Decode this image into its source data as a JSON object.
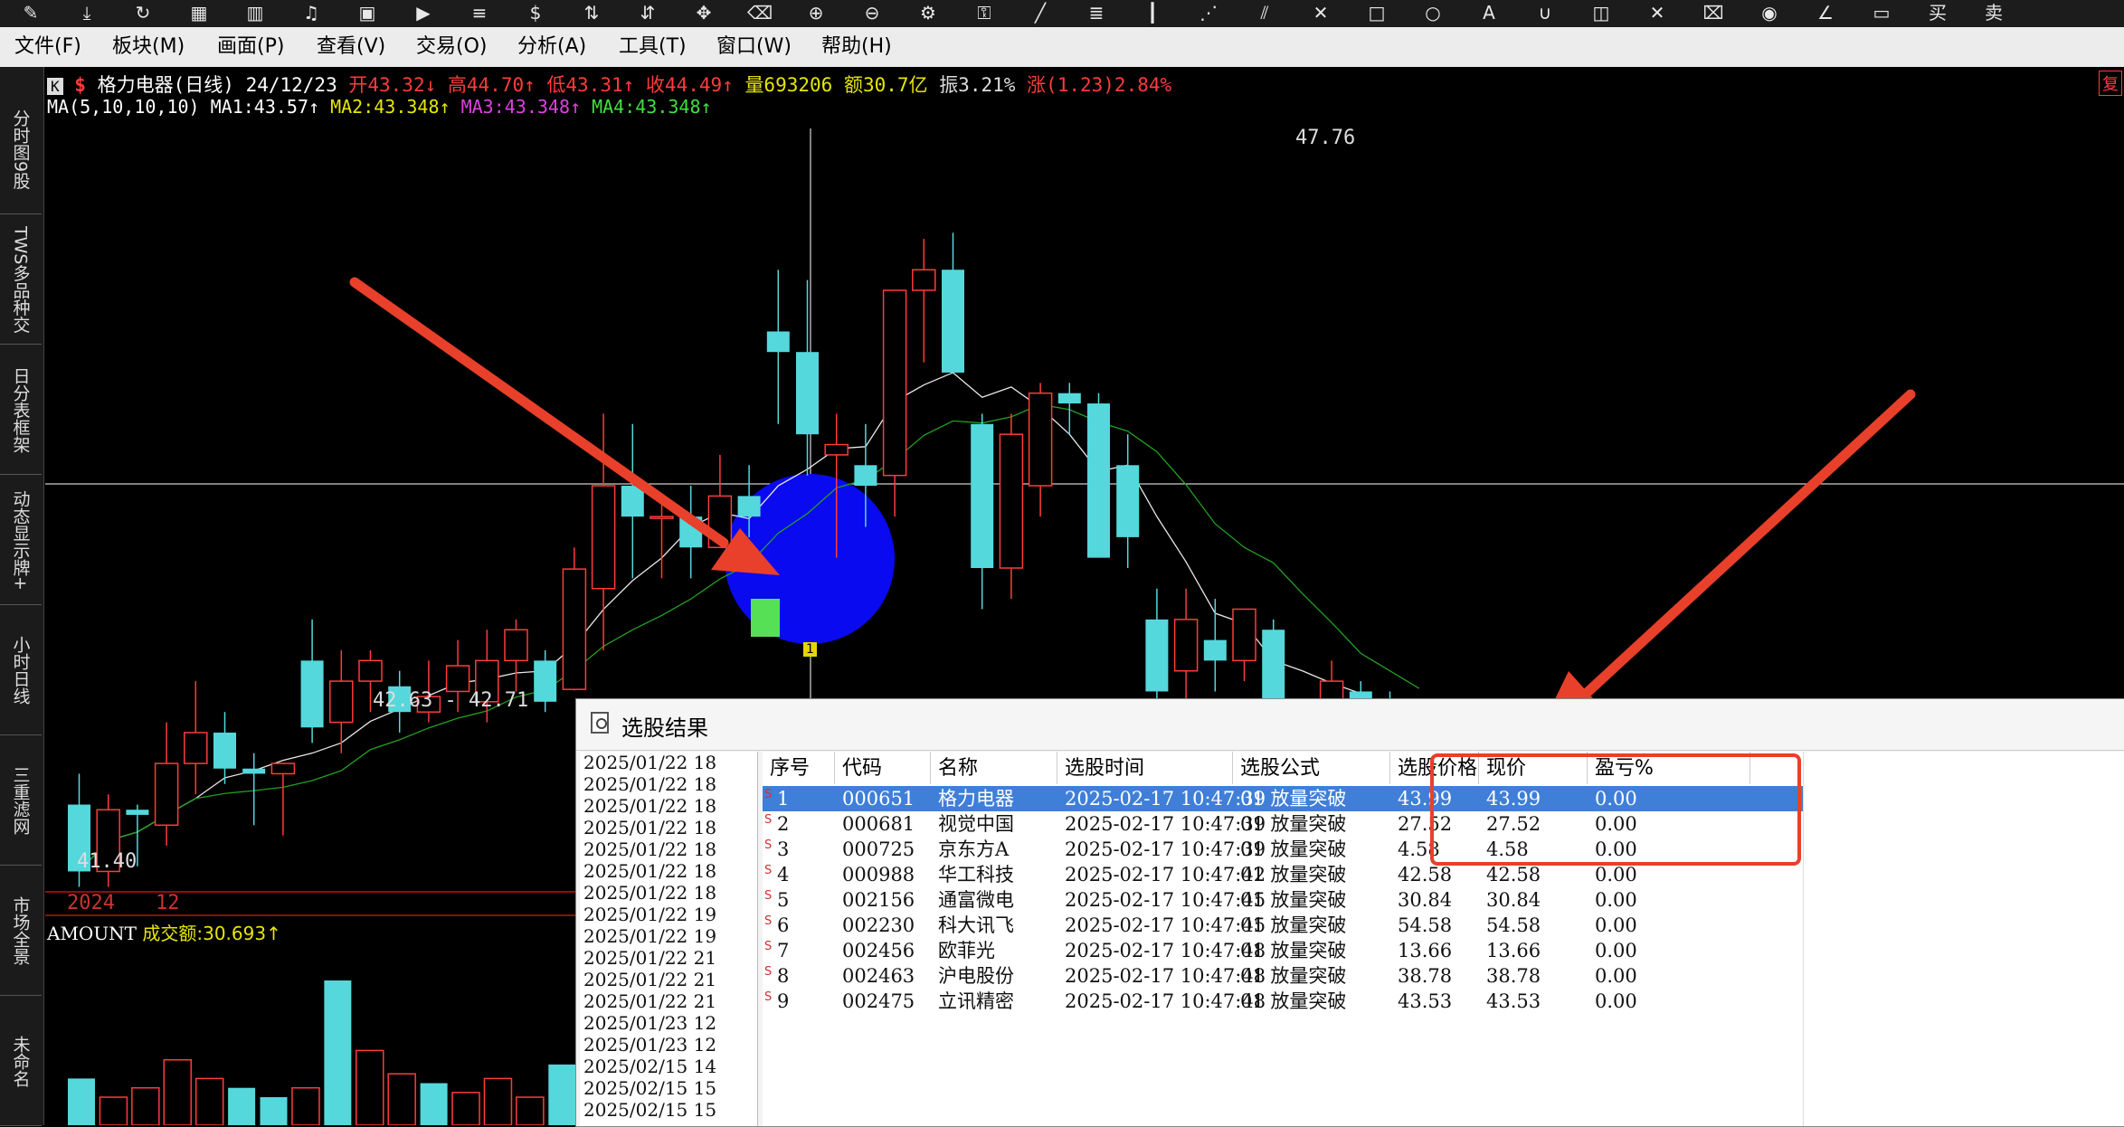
{
  "menu": [
    "文件(F)",
    "板块(M)",
    "画面(P)",
    "查看(V)",
    "交易(O)",
    "分析(A)",
    "工具(T)",
    "窗口(W)",
    "帮助(H)"
  ],
  "toolbar_icons": [
    "pen-icon",
    "download-icon",
    "refresh-icon",
    "grid-icon",
    "bar-chart-icon",
    "bell-icon",
    "image-icon",
    "play-icon",
    "list-icon",
    "dollar-icon",
    "adjust-icon",
    "align-icon",
    "move-icon",
    "eraser-icon",
    "zoom-in-icon",
    "zoom-out-icon",
    "settings-icon",
    "lock-icon",
    "line-tool-icon",
    "text-tool-icon",
    "bars-tool-icon",
    "fan-icon",
    "parallel-icon",
    "cross-icon",
    "rect-icon",
    "circle-icon",
    "letter-a-icon",
    "magnet-icon",
    "layers-icon",
    "close-icon",
    "trash-icon",
    "eye-icon",
    "angle-icon",
    "frame-icon",
    "buy-icon",
    "sell-icon"
  ],
  "sidebar_tabs": [
    "分时图9股",
    "TWS多品种交",
    "日分表框架",
    "动态显示牌+",
    "小时日线",
    "三重滤网",
    "市场全景",
    "未命名"
  ],
  "info": {
    "k_badge": "K",
    "s_badge": "$",
    "title": "格力电器(日线)",
    "date": "24/12/23",
    "open": "开43.32↓",
    "high": "高44.70↑",
    "low": "低43.31↑",
    "close": "收44.49↑",
    "volume": "量693206",
    "amount": "额30.7亿",
    "amplitude": "振3.21%",
    "change": "涨(1.23)2.84%",
    "right_badge": "复"
  },
  "ma": {
    "label": "MA(5,10,10,10)",
    "ma1": "MA1:43.57↑",
    "ma2": "MA2:43.348↑",
    "ma3": "MA3:43.348↑",
    "ma4": "MA4:43.348↑"
  },
  "price_labels": {
    "high": "47.76",
    "low": "41.40",
    "range": "42.63 - 42.71",
    "signal": "1"
  },
  "axis": {
    "year": "2024",
    "month": "12"
  },
  "amount_panel": {
    "label": "AMOUNT",
    "value": "成交额:30.693↑"
  },
  "colors": {
    "up": "#ff3b3b",
    "down": "#54d8dc",
    "ma1": "#e8e8e8",
    "ma2": "#22a022",
    "annotation": "#e8402a",
    "highlight_circle": "#0a0af0",
    "signal_green": "#55e055",
    "selection": "#3f7fd8"
  },
  "chart_data": {
    "type": "candlestick",
    "candles": [
      {
        "o": 42.2,
        "h": 42.5,
        "l": 41.4,
        "c": 41.55
      },
      {
        "o": 41.55,
        "h": 42.3,
        "l": 41.4,
        "c": 42.15
      },
      {
        "o": 42.15,
        "h": 42.2,
        "l": 41.6,
        "c": 42.1
      },
      {
        "o": 42.0,
        "h": 43.0,
        "l": 41.8,
        "c": 42.6
      },
      {
        "o": 42.6,
        "h": 43.4,
        "l": 42.3,
        "c": 42.9
      },
      {
        "o": 42.9,
        "h": 43.1,
        "l": 42.4,
        "c": 42.55
      },
      {
        "o": 42.55,
        "h": 42.7,
        "l": 42.0,
        "c": 42.5
      },
      {
        "o": 42.5,
        "h": 42.6,
        "l": 41.9,
        "c": 42.6
      },
      {
        "o": 43.6,
        "h": 44.0,
        "l": 42.8,
        "c": 42.95
      },
      {
        "o": 43.0,
        "h": 43.7,
        "l": 42.7,
        "c": 43.4
      },
      {
        "o": 43.4,
        "h": 43.7,
        "l": 43.1,
        "c": 43.6
      },
      {
        "o": 43.35,
        "h": 43.5,
        "l": 42.9,
        "c": 43.1
      },
      {
        "o": 43.1,
        "h": 43.6,
        "l": 43.0,
        "c": 43.25
      },
      {
        "o": 43.3,
        "h": 43.8,
        "l": 43.1,
        "c": 43.55
      },
      {
        "o": 43.2,
        "h": 43.9,
        "l": 43.0,
        "c": 43.6
      },
      {
        "o": 43.6,
        "h": 44.0,
        "l": 43.3,
        "c": 43.9
      },
      {
        "o": 43.6,
        "h": 43.7,
        "l": 43.1,
        "c": 43.2
      },
      {
        "o": 43.32,
        "h": 44.7,
        "l": 43.31,
        "c": 44.49
      },
      {
        "o": 44.3,
        "h": 46.0,
        "l": 43.7,
        "c": 45.3
      },
      {
        "o": 45.3,
        "h": 45.9,
        "l": 44.4,
        "c": 45.0
      },
      {
        "o": 45.0,
        "h": 45.2,
        "l": 44.4,
        "c": 45.0
      },
      {
        "o": 45.0,
        "h": 45.3,
        "l": 44.4,
        "c": 44.7
      },
      {
        "o": 44.7,
        "h": 45.6,
        "l": 44.7,
        "c": 45.2
      },
      {
        "o": 45.2,
        "h": 45.5,
        "l": 44.8,
        "c": 45.0
      },
      {
        "o": 46.8,
        "h": 47.4,
        "l": 45.9,
        "c": 46.6
      },
      {
        "o": 46.6,
        "h": 47.3,
        "l": 45.4,
        "c": 45.8
      },
      {
        "o": 45.6,
        "h": 46.0,
        "l": 44.6,
        "c": 45.7
      },
      {
        "o": 45.5,
        "h": 45.9,
        "l": 44.9,
        "c": 45.3
      },
      {
        "o": 45.4,
        "h": 46.6,
        "l": 45.0,
        "c": 47.2
      },
      {
        "o": 47.2,
        "h": 47.7,
        "l": 46.5,
        "c": 47.4
      },
      {
        "o": 47.4,
        "h": 47.76,
        "l": 46.7,
        "c": 46.4
      },
      {
        "o": 45.9,
        "h": 46.0,
        "l": 44.1,
        "c": 44.5
      },
      {
        "o": 44.5,
        "h": 46.0,
        "l": 44.2,
        "c": 45.8
      },
      {
        "o": 45.3,
        "h": 46.3,
        "l": 45.0,
        "c": 46.2
      },
      {
        "o": 46.2,
        "h": 46.3,
        "l": 45.8,
        "c": 46.1
      },
      {
        "o": 46.1,
        "h": 46.2,
        "l": 44.8,
        "c": 44.6
      },
      {
        "o": 45.5,
        "h": 45.8,
        "l": 44.5,
        "c": 44.8
      },
      {
        "o": 44.0,
        "h": 44.3,
        "l": 42.8,
        "c": 43.3
      },
      {
        "o": 43.5,
        "h": 44.3,
        "l": 42.9,
        "c": 44.0
      },
      {
        "o": 43.8,
        "h": 44.2,
        "l": 43.3,
        "c": 43.6
      },
      {
        "o": 43.6,
        "h": 44.1,
        "l": 43.4,
        "c": 44.1
      },
      {
        "o": 43.9,
        "h": 44.0,
        "l": 42.9,
        "c": 43.0
      },
      {
        "o": 43.0,
        "h": 43.2,
        "l": 42.5,
        "c": 42.8
      },
      {
        "o": 42.9,
        "h": 43.6,
        "l": 42.5,
        "c": 43.4
      },
      {
        "o": 43.3,
        "h": 43.4,
        "l": 42.9,
        "c": 43.1
      },
      {
        "o": 43.2,
        "h": 43.3,
        "l": 42.7,
        "c": 42.9
      },
      {
        "o": 42.9,
        "h": 43.2,
        "l": 42.6,
        "c": 43.1
      }
    ],
    "amount_bars": [
      {
        "v": 10,
        "up": false
      },
      {
        "v": 6,
        "up": true
      },
      {
        "v": 8,
        "up": true
      },
      {
        "v": 14,
        "up": true
      },
      {
        "v": 10,
        "up": true
      },
      {
        "v": 8,
        "up": false
      },
      {
        "v": 6,
        "up": false
      },
      {
        "v": 8,
        "up": true
      },
      {
        "v": 31,
        "up": false
      },
      {
        "v": 16,
        "up": true
      },
      {
        "v": 11,
        "up": true
      },
      {
        "v": 9,
        "up": false
      },
      {
        "v": 7,
        "up": true
      },
      {
        "v": 10,
        "up": true
      },
      {
        "v": 6,
        "up": true
      },
      {
        "v": 13,
        "up": false
      }
    ]
  },
  "dialog": {
    "title": "选股结果",
    "dates": [
      "2025/01/22 18",
      "2025/01/22 18",
      "2025/01/22 18",
      "2025/01/22 18",
      "2025/01/22 18",
      "2025/01/22 18",
      "2025/01/22 18",
      "2025/01/22 19",
      "2025/01/22 19",
      "2025/01/22 21",
      "2025/01/22 21",
      "2025/01/22 21",
      "2025/01/23 12",
      "2025/01/23 12",
      "2025/02/15 14",
      "2025/02/15 15",
      "2025/02/15 15"
    ],
    "headers": [
      "序号",
      "代码",
      "名称",
      "选股时间",
      "选股公式",
      "选股价格",
      "现价",
      "盈亏%"
    ],
    "rows": [
      {
        "idx": "1",
        "code": "000651",
        "name": "格力电器",
        "time": "2025-02-17 10:47:39",
        "formula": "01 放量突破",
        "price": "43.99",
        "now": "43.99",
        "pl": "0.00"
      },
      {
        "idx": "2",
        "code": "000681",
        "name": "视觉中国",
        "time": "2025-02-17 10:47:39",
        "formula": "01 放量突破",
        "price": "27.52",
        "now": "27.52",
        "pl": "0.00"
      },
      {
        "idx": "3",
        "code": "000725",
        "name": "京东方A",
        "time": "2025-02-17 10:47:39",
        "formula": "01 放量突破",
        "price": "4.58",
        "now": "4.58",
        "pl": "0.00"
      },
      {
        "idx": "4",
        "code": "000988",
        "name": "华工科技",
        "time": "2025-02-17 10:47:42",
        "formula": "01 放量突破",
        "price": "42.58",
        "now": "42.58",
        "pl": "0.00"
      },
      {
        "idx": "5",
        "code": "002156",
        "name": "通富微电",
        "time": "2025-02-17 10:47:45",
        "formula": "01 放量突破",
        "price": "30.84",
        "now": "30.84",
        "pl": "0.00"
      },
      {
        "idx": "6",
        "code": "002230",
        "name": "科大讯飞",
        "time": "2025-02-17 10:47:45",
        "formula": "01 放量突破",
        "price": "54.58",
        "now": "54.58",
        "pl": "0.00"
      },
      {
        "idx": "7",
        "code": "002456",
        "name": "欧菲光",
        "time": "2025-02-17 10:47:48",
        "formula": "01 放量突破",
        "price": "13.66",
        "now": "13.66",
        "pl": "0.00"
      },
      {
        "idx": "8",
        "code": "002463",
        "name": "沪电股份",
        "time": "2025-02-17 10:47:48",
        "formula": "01 放量突破",
        "price": "38.78",
        "now": "38.78",
        "pl": "0.00"
      },
      {
        "idx": "9",
        "code": "002475",
        "name": "立讯精密",
        "time": "2025-02-17 10:47:48",
        "formula": "01 放量突破",
        "price": "43.53",
        "now": "43.53",
        "pl": "0.00"
      }
    ]
  }
}
